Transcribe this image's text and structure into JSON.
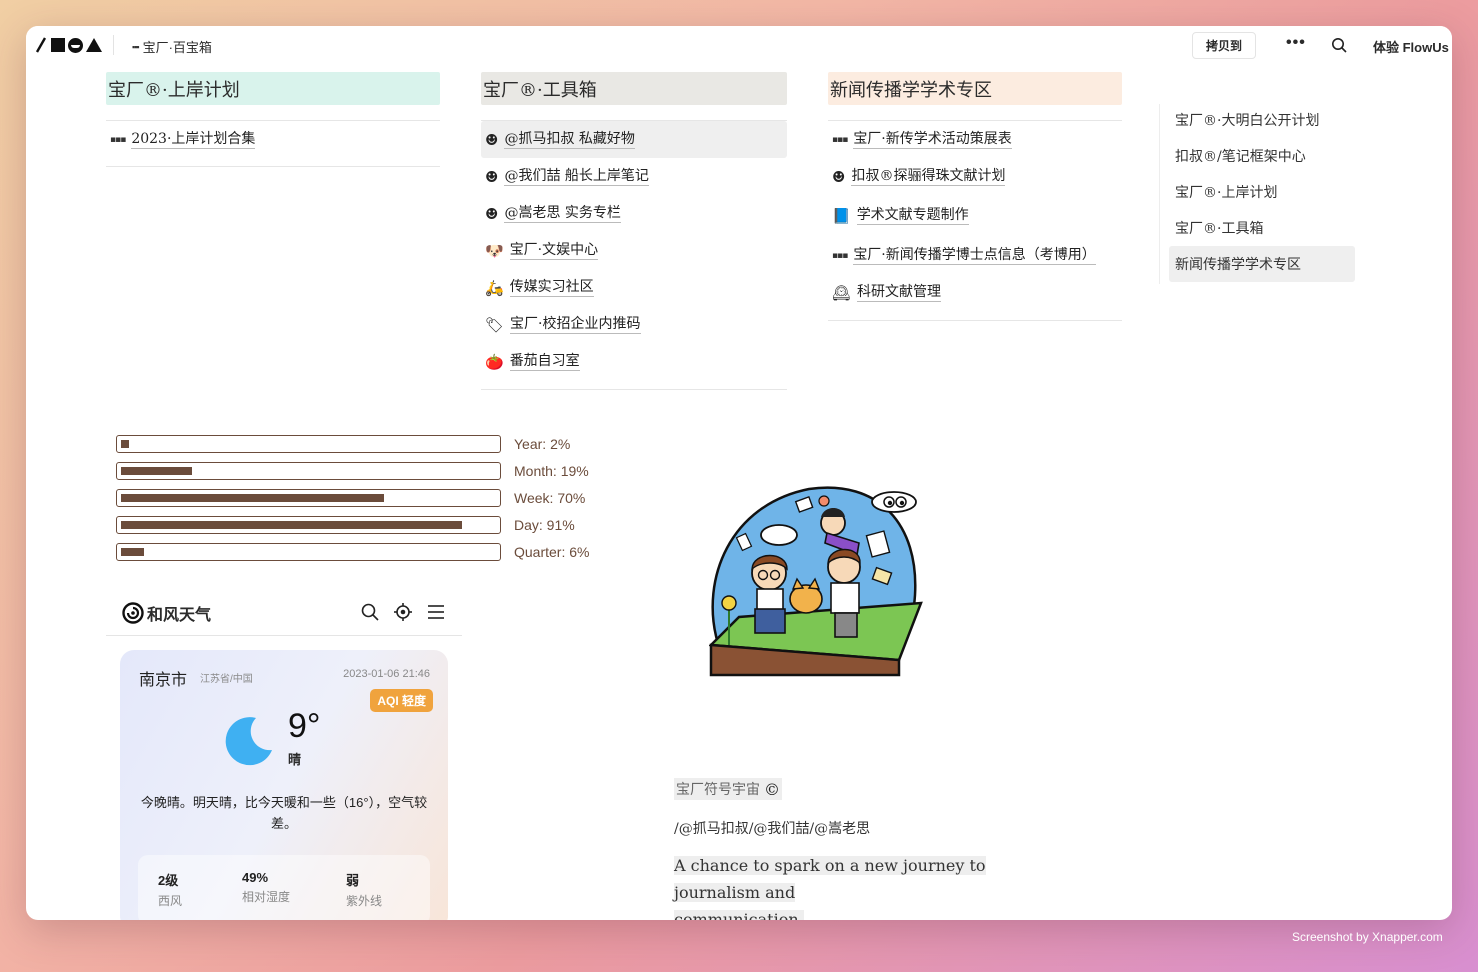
{
  "topbar": {
    "breadcrumb": "宝厂·百宝箱",
    "copy_button": "拷贝到",
    "more": "•••",
    "try_link": "体验 FlowUs"
  },
  "columns": [
    {
      "title": "宝厂®·上岸计划",
      "header_color": "#d9f3ec",
      "items": [
        {
          "icon": "dots-icon",
          "emoji": "",
          "label": "2023·上岸计划合集",
          "highlighted": false
        }
      ]
    },
    {
      "title": "宝厂®·工具箱",
      "header_color": "#e9e8e4",
      "items": [
        {
          "icon": "person-icon",
          "emoji": "☻",
          "label": "@抓马扣叔 私藏好物",
          "highlighted": true
        },
        {
          "icon": "person-icon",
          "emoji": "☻",
          "label": "@我们喆 船长上岸笔记",
          "highlighted": false
        },
        {
          "icon": "person-icon",
          "emoji": "☻",
          "label": "@嵩老思 实务专栏",
          "highlighted": false
        },
        {
          "icon": "dog-icon",
          "emoji": "🐶",
          "label": "宝厂·文娱中心",
          "highlighted": false
        },
        {
          "icon": "scooter-icon",
          "emoji": "🛵",
          "label": "传媒实习社区",
          "highlighted": false
        },
        {
          "icon": "tag-icon",
          "emoji": "🏷",
          "label": "宝厂·校招企业内推码",
          "highlighted": false
        },
        {
          "icon": "tomato-icon",
          "emoji": "🍅",
          "label": "番茄自习室",
          "highlighted": false
        }
      ]
    },
    {
      "title": "新闻传播学学术专区",
      "header_color": "#fcece0",
      "items": [
        {
          "icon": "dots-icon",
          "emoji": "",
          "label": "宝厂·新传学术活动策展表",
          "highlighted": false
        },
        {
          "icon": "person-icon",
          "emoji": "☻",
          "label": "扣叔®探骊得珠文献计划",
          "highlighted": false
        },
        {
          "icon": "book-icon",
          "emoji": "📘",
          "label": "学术文献专题制作",
          "highlighted": false
        },
        {
          "icon": "dots-icon",
          "emoji": "",
          "label": "宝厂·新闻传播学博士点信息（考博用）",
          "highlighted": false
        },
        {
          "icon": "clock-icon",
          "emoji": "🕰",
          "label": "科研文献管理",
          "highlighted": false
        }
      ]
    }
  ],
  "outline": [
    {
      "label": "宝厂®·大明白公开计划",
      "active": false
    },
    {
      "label": "扣叔®/笔记框架中心",
      "active": false
    },
    {
      "label": "宝厂®·上岸计划",
      "active": false
    },
    {
      "label": "宝厂®·工具箱",
      "active": false
    },
    {
      "label": "新闻传播学学术专区",
      "active": true
    }
  ],
  "progress": [
    {
      "label": "Year: 2%",
      "percent": 2
    },
    {
      "label": "Month: 19%",
      "percent": 19
    },
    {
      "label": "Week: 70%",
      "percent": 70
    },
    {
      "label": "Day: 91%",
      "percent": 91
    },
    {
      "label": "Quarter: 6%",
      "percent": 6
    }
  ],
  "progress_color": "#6b4c3b",
  "weather": {
    "brand": "和风天气",
    "city": "南京市",
    "province": "江苏省/中国",
    "datetime": "2023-01-06 21:46",
    "aqi": "AQI 轻度",
    "temperature": "9°",
    "condition": "晴",
    "description": "今晚晴。明天晴，比今天暖和一些（16°），空气较差。",
    "stats": [
      {
        "value": "2级",
        "key": "西风"
      },
      {
        "value": "49%",
        "key": "相对湿度"
      },
      {
        "value": "弱",
        "key": "紫外线"
      }
    ],
    "moon_color": "#3fb0f2",
    "aqi_color": "#f0a33d"
  },
  "signature": {
    "title": "宝厂符号宇宙",
    "title_icon": "copyright-icon",
    "authors": "/@抓马扣叔/@我们喆/@嵩老思",
    "quote_line1": "A chance to spark on a new journey to journalism and",
    "quote_line2": "communication."
  },
  "credit": "Screenshot by Xnapper.com"
}
